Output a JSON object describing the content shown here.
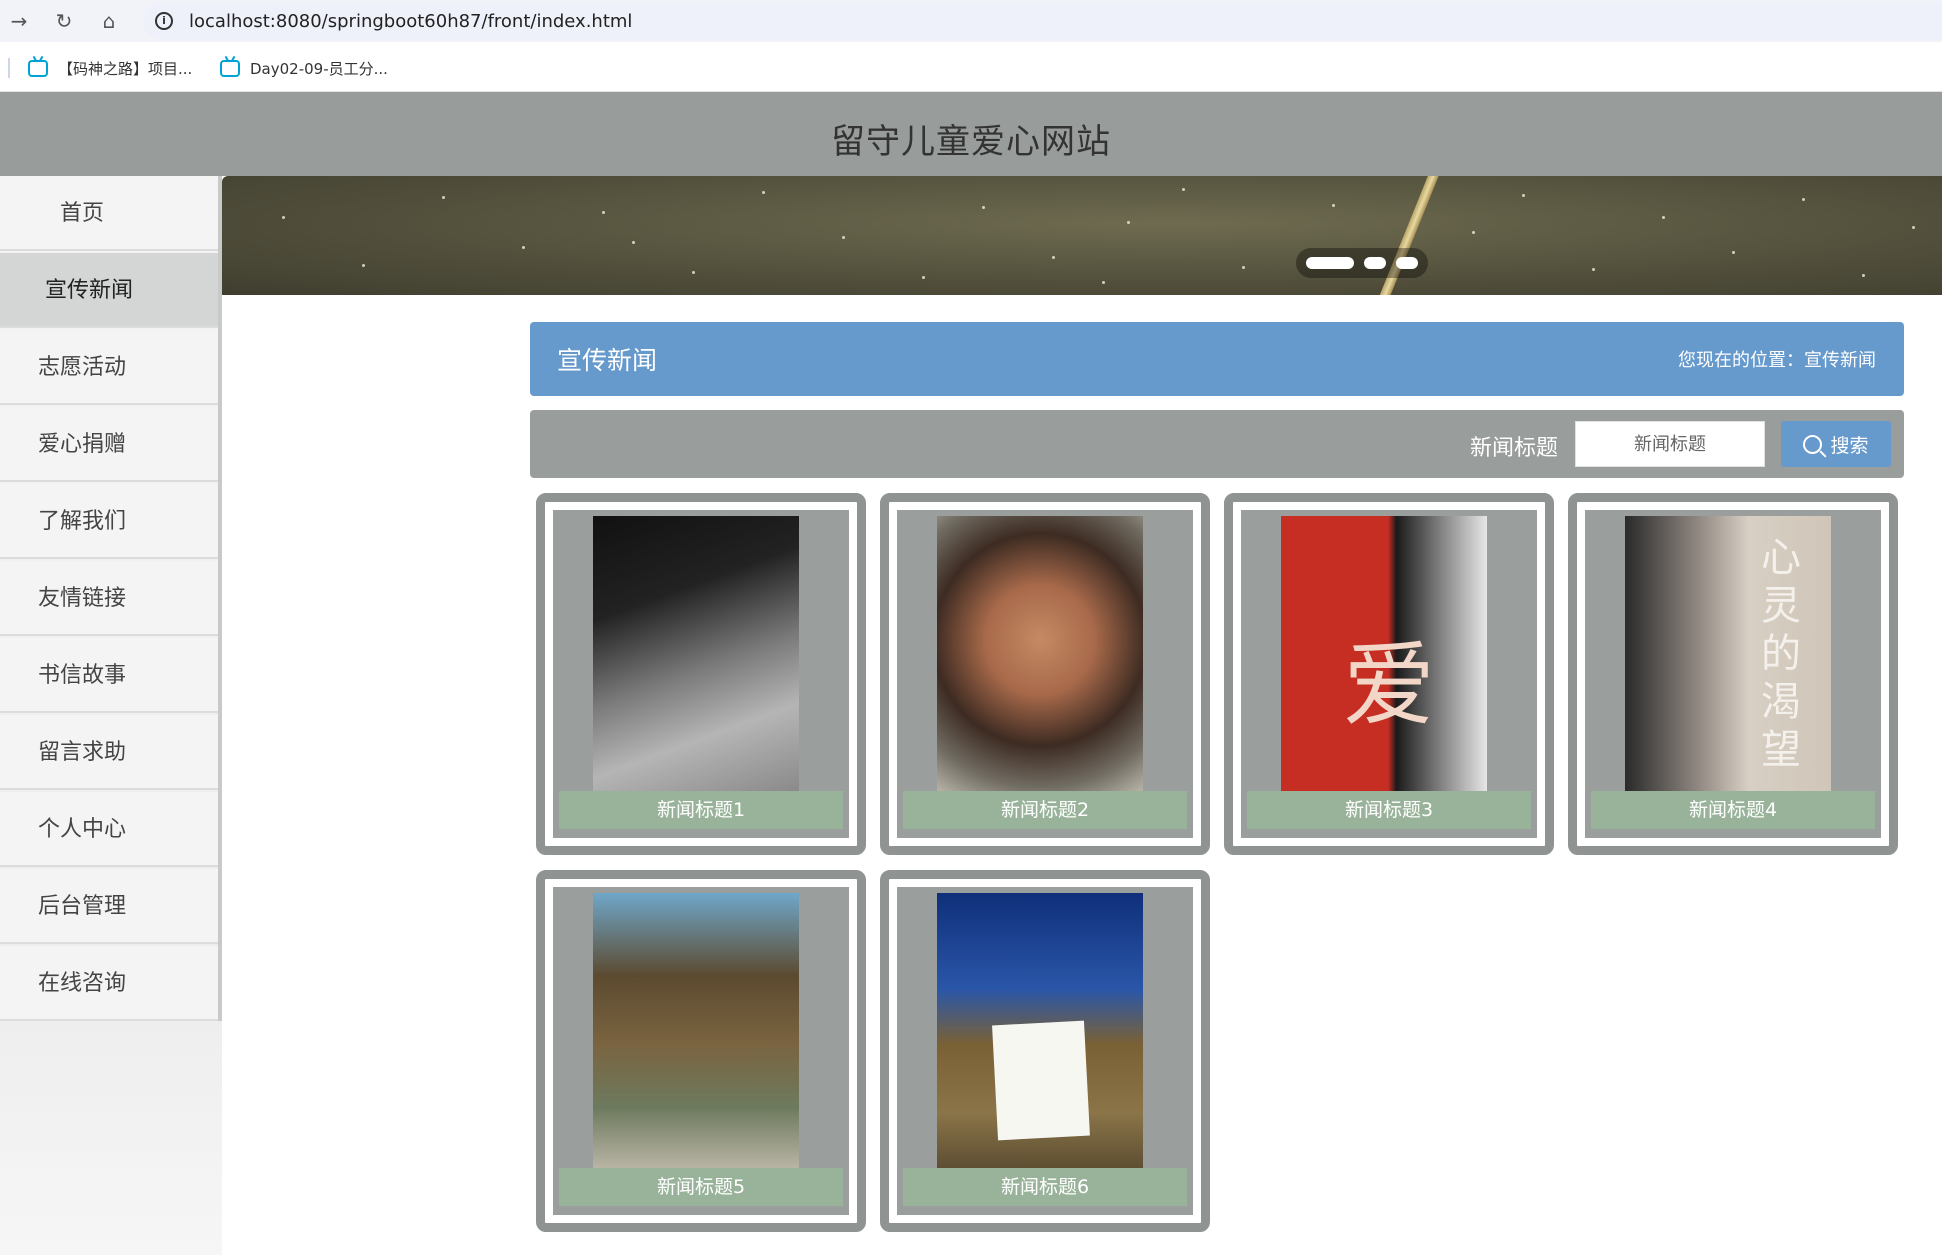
{
  "browser": {
    "url": "localhost:8080/springboot60h87/front/index.html",
    "bookmarks": [
      "【码神之路】项目...",
      "Day02-09-员工分..."
    ]
  },
  "site": {
    "title": "留守儿童爱心网站"
  },
  "menu": [
    "首页",
    "宣传新闻",
    "志愿活动",
    "爱心捐赠",
    "了解我们",
    "友情链接",
    "书信故事",
    "留言求助",
    "个人中心",
    "后台管理",
    "在线咨询"
  ],
  "menu_active": "宣传新闻",
  "banner": {
    "slide_count": 3,
    "active_slide": 1
  },
  "main": {
    "title": "宣传新闻",
    "location": "您现在的位置：宣传新闻",
    "search": {
      "label": "新闻标题",
      "placeholder": "新闻标题",
      "button": "搜索"
    }
  },
  "poster_text": {
    "card4": "心灵的渴望",
    "card3": "爱"
  },
  "news": [
    "新闻标题1",
    "新闻标题2",
    "新闻标题3",
    "新闻标题4",
    "新闻标题5",
    "新闻标题6"
  ],
  "colors": {
    "header": "#989c9a",
    "accent": "#6699cc",
    "caption": "#99b39a",
    "card_border": "#8f9391"
  }
}
